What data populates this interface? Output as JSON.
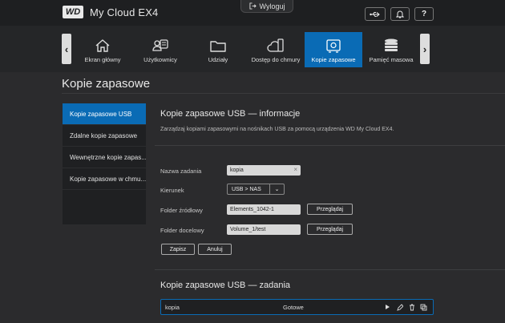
{
  "app": {
    "brand": "WD",
    "product": "My Cloud EX4"
  },
  "header": {
    "logout_label": "Wyloguj",
    "icons": [
      "usb-icon",
      "bell-icon",
      "help-icon"
    ],
    "help_label": "?"
  },
  "nav": {
    "items": [
      {
        "label": "Ekran główny",
        "icon": "home-icon"
      },
      {
        "label": "Użytkownicy",
        "icon": "users-icon"
      },
      {
        "label": "Udziały",
        "icon": "folder-icon"
      },
      {
        "label": "Dostęp do chmury",
        "icon": "cloud-icon"
      },
      {
        "label": "Kopie zapasowe",
        "icon": "safe-icon",
        "active": true
      },
      {
        "label": "Pamięć masowa",
        "icon": "storage-icon"
      }
    ]
  },
  "page": {
    "title": "Kopie zapasowe"
  },
  "sidebar": {
    "items": [
      {
        "label": "Kopie zapasowe USB",
        "active": true
      },
      {
        "label": "Zdalne kopie zapasowe"
      },
      {
        "label": "Wewnętrzne kopie zapas..."
      },
      {
        "label": "Kopie zapasowe w chmu..."
      }
    ]
  },
  "info": {
    "title": "Kopie zapasowe USB — informacje",
    "description": "Zarządzaj kopiami zapasowymi na nośnikach USB za pomocą urządzenia WD My Cloud EX4."
  },
  "form": {
    "job_name_label": "Nazwa zadania",
    "job_name_value": "kopia",
    "direction_label": "Kierunek",
    "direction_value": "USB > NAS",
    "source_label": "Folder źródłowy",
    "source_value": "Elements_1042-1",
    "dest_label": "Folder docelowy",
    "dest_value": "Volume_1/test",
    "browse_label": "Przeglądaj",
    "save_label": "Zapisz",
    "cancel_label": "Anuluj"
  },
  "tasks": {
    "title": "Kopie zapasowe USB — zadania",
    "rows": [
      {
        "name": "kopia",
        "status": "Gotowe"
      }
    ]
  },
  "colors": {
    "accent": "#0a6bb5",
    "background": "#2b2b2d",
    "topbar": "#1e1f21"
  }
}
